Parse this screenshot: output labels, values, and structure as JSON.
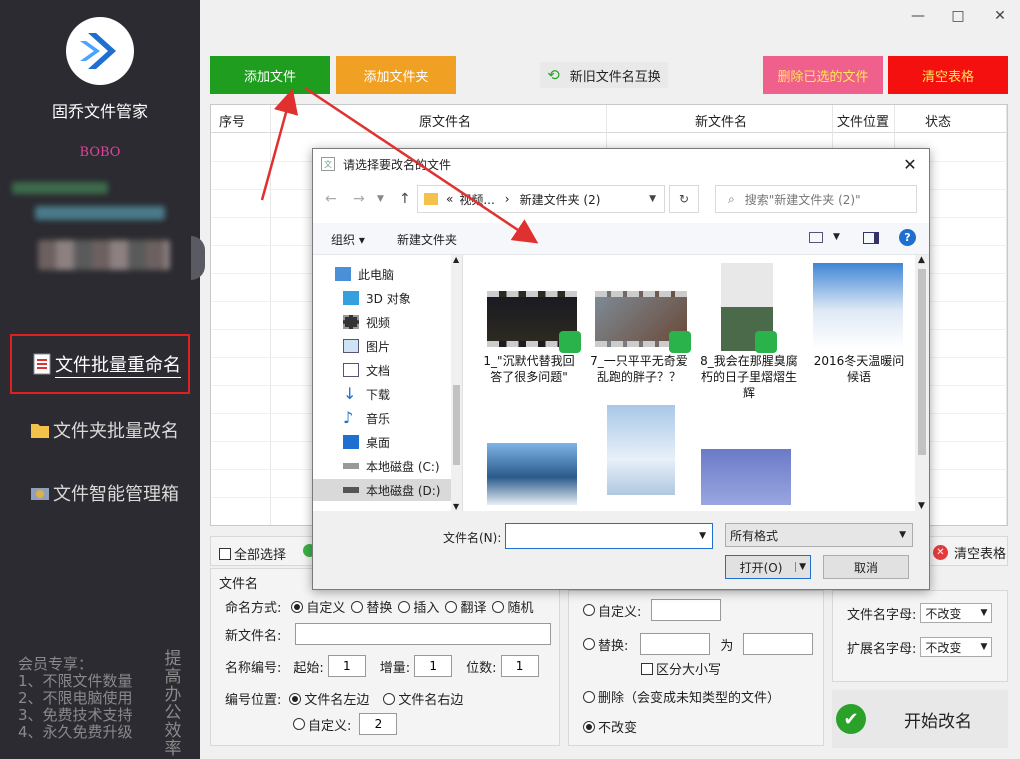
{
  "app": {
    "name": "固乔文件管家",
    "user": "BOBO"
  },
  "nav": [
    {
      "label": "文件批量重命名"
    },
    {
      "label": "文件夹批量改名"
    },
    {
      "label": "文件智能管理箱"
    }
  ],
  "member": {
    "lines": [
      "会员专享：",
      "1、不限文件数量",
      "2、不限电脑使用",
      "3、免费技术支持",
      "4、永久免费升级"
    ],
    "slogan": "提高办公效率"
  },
  "toolbar": {
    "add_file": "添加文件",
    "add_folder": "添加文件夹",
    "swap_names": "新旧文件名互换",
    "delete_selected": "删除已选的文件",
    "clear_table": "清空表格"
  },
  "table": {
    "columns": [
      "序号",
      "原文件名",
      "新文件名",
      "文件位置",
      "状态"
    ]
  },
  "select_bar": {
    "select_all": "全部选择",
    "clear_table": "清空表格"
  },
  "rename_panel": {
    "section": "文件名",
    "mode_label": "命名方式:",
    "modes": [
      "自定义",
      "替换",
      "插入",
      "翻译",
      "随机"
    ],
    "new_name_label": "新文件名:",
    "new_name_value": "",
    "number_label": "名称编号:",
    "start_label": "起始:",
    "start_value": "1",
    "step_label": "增量:",
    "step_value": "1",
    "digits_label": "位数:",
    "digits_value": "1",
    "position_label": "编号位置:",
    "pos_left": "文件名左边",
    "pos_right": "文件名右边",
    "pos_custom": "自定义:",
    "pos_custom_value": "2"
  },
  "ext_panel": {
    "custom": "自定义:",
    "replace": "替换:",
    "to": "为",
    "case_sensitive": "区分大小写",
    "delete": "删除（会变成未知类型的文件）",
    "unchanged": "不改变"
  },
  "case_panel": {
    "name_case_label": "文件名字母:",
    "name_case_value": "不改变",
    "ext_case_label": "扩展名字母:",
    "ext_case_value": "不改变"
  },
  "start_button": "开始改名",
  "dialog": {
    "title": "请选择要改名的文件",
    "path": [
      "«",
      "视频...",
      "›",
      "新建文件夹 (2)"
    ],
    "search_placeholder": "搜索\"新建文件夹 (2)\"",
    "organize": "组织 ▾",
    "new_folder": "新建文件夹",
    "tree": [
      "此电脑",
      "3D 对象",
      "视频",
      "图片",
      "文档",
      "下载",
      "音乐",
      "桌面",
      "本地磁盘 (C:)",
      "本地磁盘 (D:)"
    ],
    "files": [
      {
        "name": "1_\"沉默代替我回答了很多问题\"",
        "kind": "video"
      },
      {
        "name": "7_一只平平无奇爱乱跑的胖子？？",
        "kind": "video"
      },
      {
        "name": "8_我会在那腥臭腐朽的日子里熠熠生辉",
        "kind": "video"
      },
      {
        "name": "2016冬天温暖问候语",
        "kind": "image"
      },
      {
        "name": "",
        "kind": "image"
      },
      {
        "name": "",
        "kind": "image"
      },
      {
        "name": "",
        "kind": "image"
      }
    ],
    "filename_label": "文件名(N):",
    "filename_value": "",
    "filter": "所有格式",
    "open": "打开(O)",
    "cancel": "取消"
  },
  "colors": {
    "sidebar": "#2b2b31",
    "add_file": "#1f9d1f",
    "add_folder": "#f0a022",
    "delete": "#f0608c",
    "clear": "#f51010",
    "highlight": "#e02020"
  }
}
